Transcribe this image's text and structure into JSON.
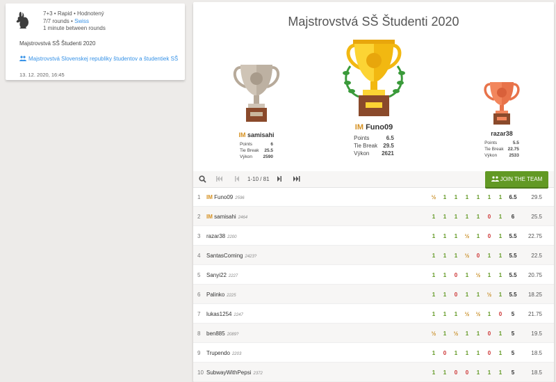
{
  "info": {
    "line1": "7+3 • Rapid • Hodnotený",
    "rounds": "7/7 rounds",
    "sep": " • ",
    "system": "Swiss",
    "line3": "1 minute between rounds",
    "tournament_name": "Majstrovstvá SŠ Študenti 2020",
    "team_link": "Majstrovstvá Slovenskej republiky študentov a študentiek SŠ",
    "date": "13. 12. 2020, 16:45"
  },
  "main": {
    "title": "Majstrovstvá SŠ Študenti 2020"
  },
  "podium": [
    {
      "rank": 1,
      "title": "IM",
      "name": "Funo09",
      "points": "6.5",
      "tiebreak": "29.5",
      "perf": "2621"
    },
    {
      "rank": 2,
      "title": "IM",
      "name": "samisahi",
      "points": "6",
      "tiebreak": "25.5",
      "perf": "2590"
    },
    {
      "rank": 3,
      "title": "",
      "name": "razar38",
      "points": "5.5",
      "tiebreak": "22.75",
      "perf": "2533"
    }
  ],
  "stat_labels": {
    "points": "Points",
    "tiebreak": "Tie Break",
    "perf": "Výkon"
  },
  "toolbar": {
    "pager": "1-10 / 81",
    "join": "JOIN THE TEAM"
  },
  "standings": [
    {
      "rank": "1",
      "title": "IM",
      "name": "Funo09",
      "rating": "2596",
      "results": [
        "½",
        "1",
        "1",
        "1",
        "1",
        "1",
        "1"
      ],
      "points": "6.5",
      "tb": "29.5"
    },
    {
      "rank": "2",
      "title": "IM",
      "name": "samisahi",
      "rating": "2464",
      "results": [
        "1",
        "1",
        "1",
        "1",
        "1",
        "0",
        "1"
      ],
      "points": "6",
      "tb": "25.5"
    },
    {
      "rank": "3",
      "title": "",
      "name": "razar38",
      "rating": "2200",
      "results": [
        "1",
        "1",
        "1",
        "½",
        "1",
        "0",
        "1"
      ],
      "points": "5.5",
      "tb": "22.75"
    },
    {
      "rank": "4",
      "title": "",
      "name": "SantasComing",
      "rating": "2423?",
      "results": [
        "1",
        "1",
        "1",
        "½",
        "0",
        "1",
        "1"
      ],
      "points": "5.5",
      "tb": "22.5"
    },
    {
      "rank": "5",
      "title": "",
      "name": "Sanyi22",
      "rating": "2227",
      "results": [
        "1",
        "1",
        "0",
        "1",
        "½",
        "1",
        "1"
      ],
      "points": "5.5",
      "tb": "20.75"
    },
    {
      "rank": "6",
      "title": "",
      "name": "Palinko",
      "rating": "2225",
      "results": [
        "1",
        "1",
        "0",
        "1",
        "1",
        "½",
        "1"
      ],
      "points": "5.5",
      "tb": "18.25"
    },
    {
      "rank": "7",
      "title": "",
      "name": "lukas1254",
      "rating": "2247",
      "results": [
        "1",
        "1",
        "1",
        "½",
        "½",
        "1",
        "0"
      ],
      "points": "5",
      "tb": "21.75"
    },
    {
      "rank": "8",
      "title": "",
      "name": "ben885",
      "rating": "2089?",
      "results": [
        "½",
        "1",
        "½",
        "1",
        "1",
        "0",
        "1"
      ],
      "points": "5",
      "tb": "19.5"
    },
    {
      "rank": "9",
      "title": "",
      "name": "Trupendo",
      "rating": "2203",
      "results": [
        "1",
        "0",
        "1",
        "1",
        "1",
        "0",
        "1"
      ],
      "points": "5",
      "tb": "18.5"
    },
    {
      "rank": "10",
      "title": "",
      "name": "SubwayWithPepsi",
      "rating": "2372",
      "results": [
        "1",
        "1",
        "0",
        "0",
        "1",
        "1",
        "1"
      ],
      "points": "5",
      "tb": "18.5"
    }
  ]
}
